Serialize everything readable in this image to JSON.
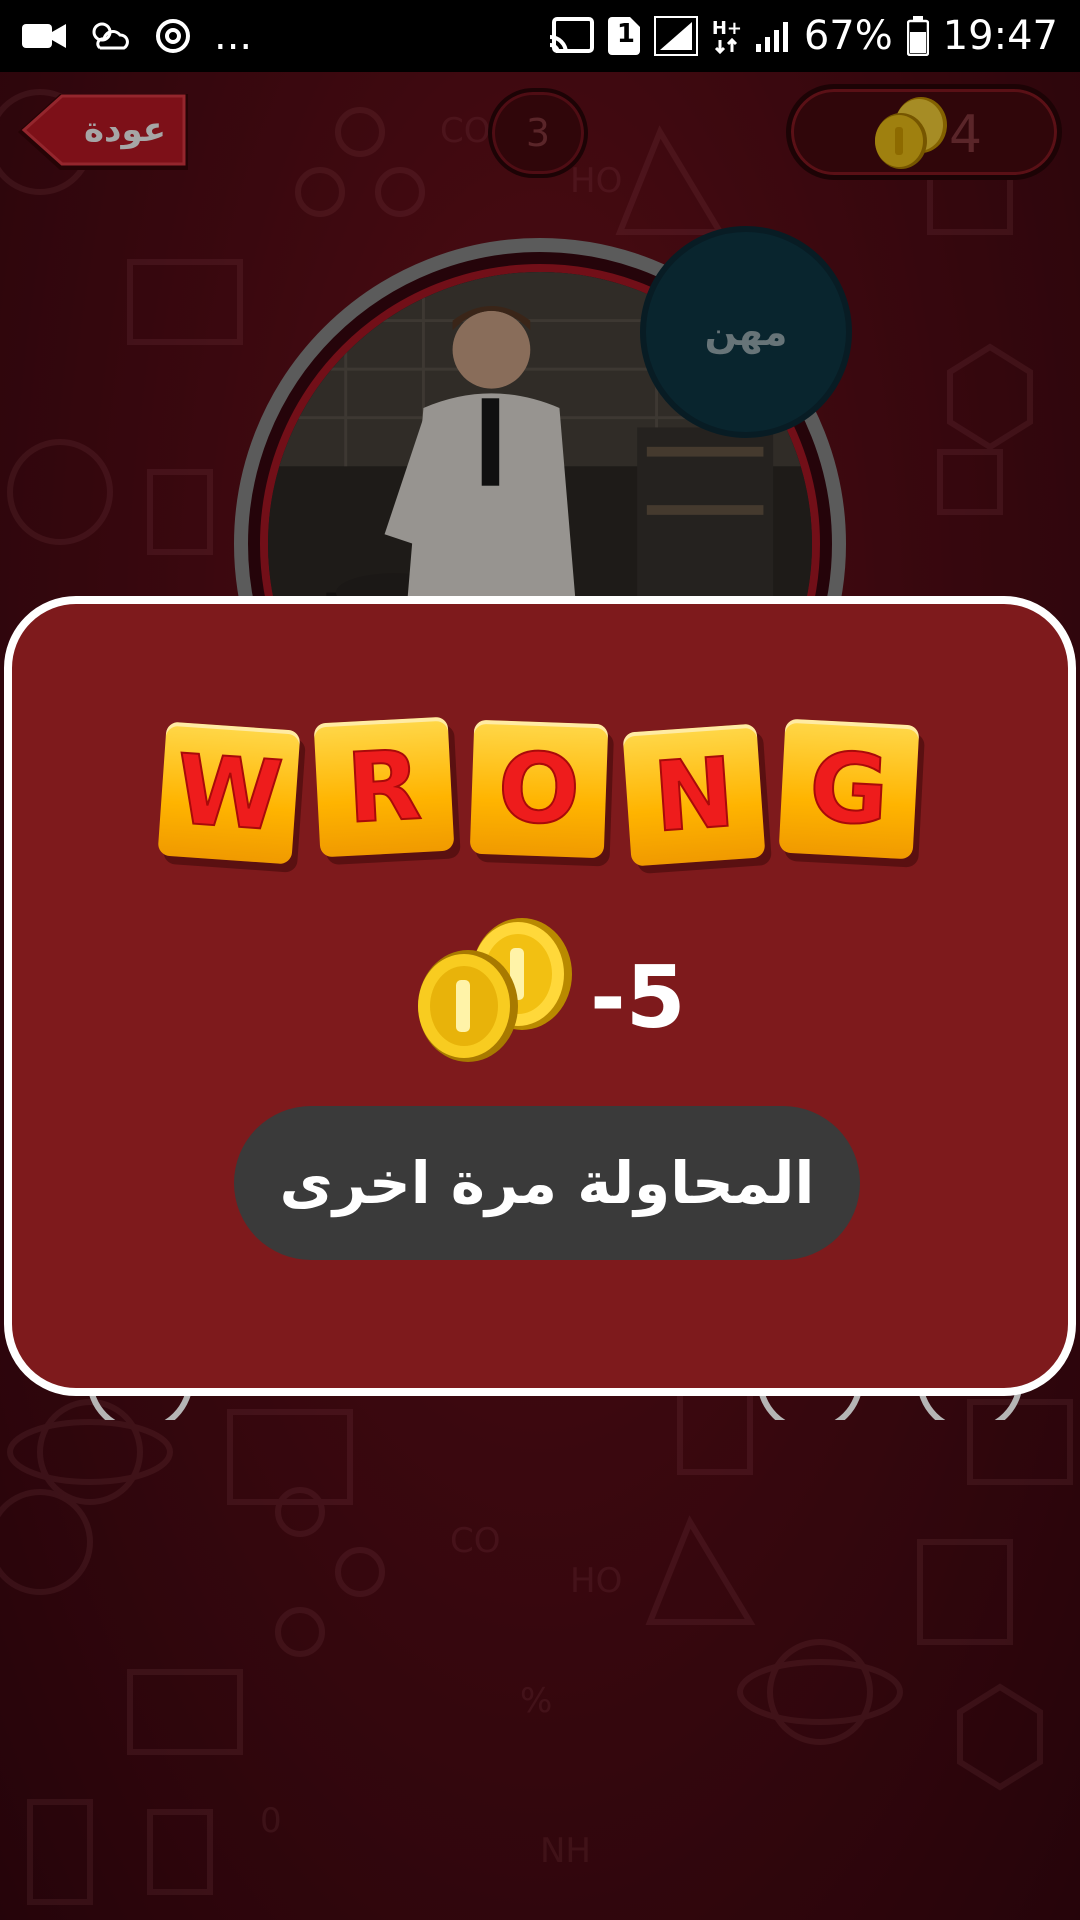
{
  "status_bar": {
    "battery": "67%",
    "time": "19:47",
    "sim_slot": "1",
    "overflow": "...",
    "network_type": "H+",
    "icons": [
      "video-camera-icon",
      "weather-icon",
      "sync-icon",
      "cast-icon",
      "sim-icon",
      "signal-icon",
      "network-type-icon",
      "signal-icon",
      "battery-icon"
    ]
  },
  "header": {
    "back_label": "عودة",
    "level": "3",
    "coins": "4"
  },
  "question": {
    "category": "مهن"
  },
  "dialog": {
    "title_letters": [
      "W",
      "R",
      "O",
      "N",
      "G"
    ],
    "penalty": "-5",
    "retry_label": "المحاولة مرة اخرى"
  },
  "colors": {
    "background": "#5a0d17",
    "dialog": "#7e1a1c",
    "tile": "#ffc21a",
    "tile_letter": "#ee1c1c",
    "retry_button": "#3a3a3a",
    "category_badge": "#0f3a48"
  }
}
